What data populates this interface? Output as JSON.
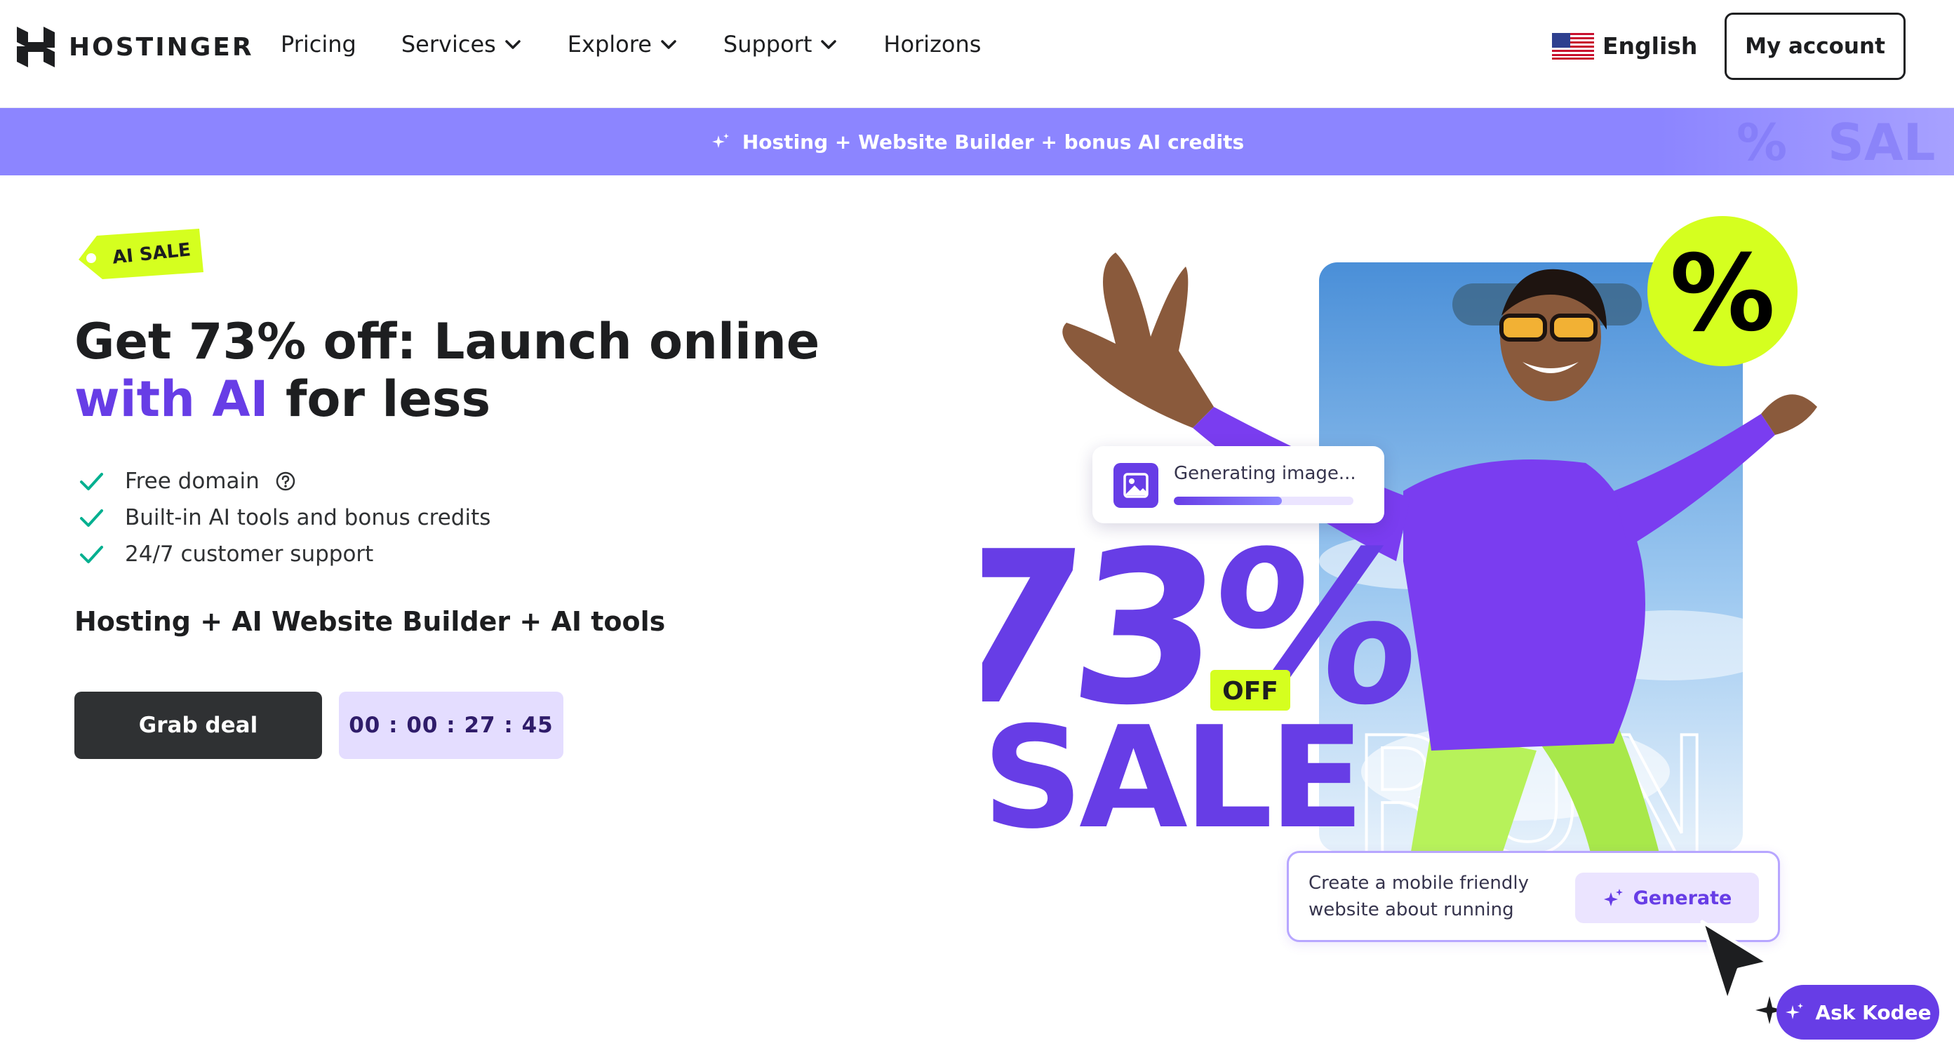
{
  "brand": {
    "name": "HOSTINGER",
    "logo_icon": "hostinger-logo-icon"
  },
  "nav": {
    "items": [
      {
        "label": "Pricing",
        "has_dropdown": false
      },
      {
        "label": "Services",
        "has_dropdown": true
      },
      {
        "label": "Explore",
        "has_dropdown": true
      },
      {
        "label": "Support",
        "has_dropdown": true
      },
      {
        "label": "Horizons",
        "has_dropdown": false
      }
    ],
    "language": {
      "label": "English",
      "flag_icon": "us-flag-icon"
    },
    "account_button": "My account"
  },
  "banner": {
    "text": "Hosting + Website Builder + bonus AI credits",
    "icon": "sparkle-icon",
    "background": "#8c85ff"
  },
  "hero": {
    "tag": "AI SALE",
    "headline": {
      "part1": "Get 73% off: Launch online",
      "accent": "with AI",
      "part2": "for less"
    },
    "features": [
      {
        "text": "Free domain",
        "has_help": true
      },
      {
        "text": "Built-in AI tools and bonus credits",
        "has_help": false
      },
      {
        "text": "24/7 customer support",
        "has_help": false
      }
    ],
    "sub_heading": "Hosting + AI Website Builder + AI tools",
    "cta_button": "Grab deal",
    "countdown": "00 : 00 : 27 : 45"
  },
  "art": {
    "discount": "73%",
    "off_label": "OFF",
    "sale_word": "SALE",
    "run_word": "RUN",
    "percent_badge": "%",
    "generating_card": {
      "text": "Generating image...",
      "progress": 0.6,
      "icon": "image-icon"
    },
    "prompt_card": {
      "text": "Create a mobile friendly website about running",
      "button": "Generate",
      "button_icon": "sparkle-icon"
    }
  },
  "assistant": {
    "label": "Ask Kodee",
    "icon": "kodee-sparkle-icon"
  },
  "colors": {
    "accent": "#673de6",
    "lime": "#d5ff1f",
    "dark": "#2f3133",
    "timer_bg": "#e4ddff",
    "check": "#00b090"
  }
}
